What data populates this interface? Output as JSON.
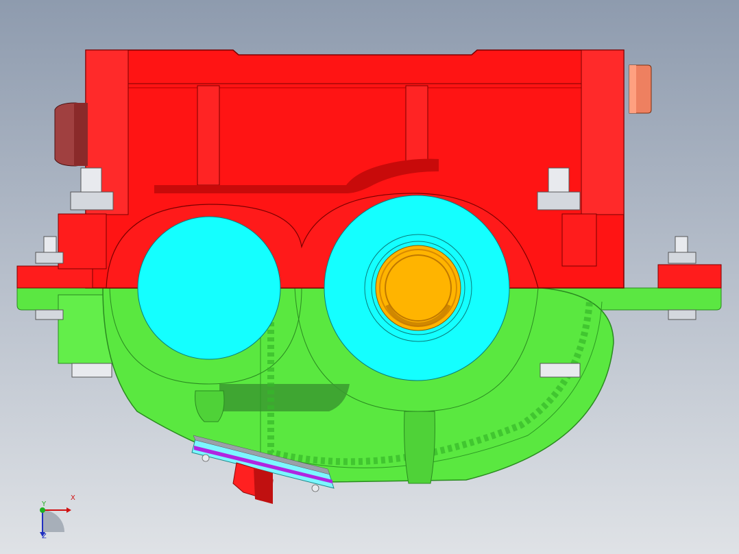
{
  "viewport": {
    "background_top": "#8e9bae",
    "background_bottom": "#dfe2e6"
  },
  "model": {
    "parts": [
      {
        "name": "upper-housing",
        "color": "#ff1414"
      },
      {
        "name": "lower-housing",
        "color": "#55ee3c"
      },
      {
        "name": "bearing-bores",
        "color": "#00ffff"
      },
      {
        "name": "shaft-bushing",
        "color": "#ffb400"
      },
      {
        "name": "drain-plug",
        "color": "#ff2020"
      },
      {
        "name": "breather-plug",
        "color": "#ee8060"
      },
      {
        "name": "side-plug",
        "color": "#a04040"
      },
      {
        "name": "bolts",
        "color": "#e8eaee"
      },
      {
        "name": "seal-ring",
        "color": "#b026e0"
      }
    ]
  },
  "triad": {
    "x_label": "X",
    "y_label": "Y",
    "z_label": "Z",
    "x_color": "#d01010",
    "y_color": "#20b020",
    "z_color": "#2030c0"
  }
}
